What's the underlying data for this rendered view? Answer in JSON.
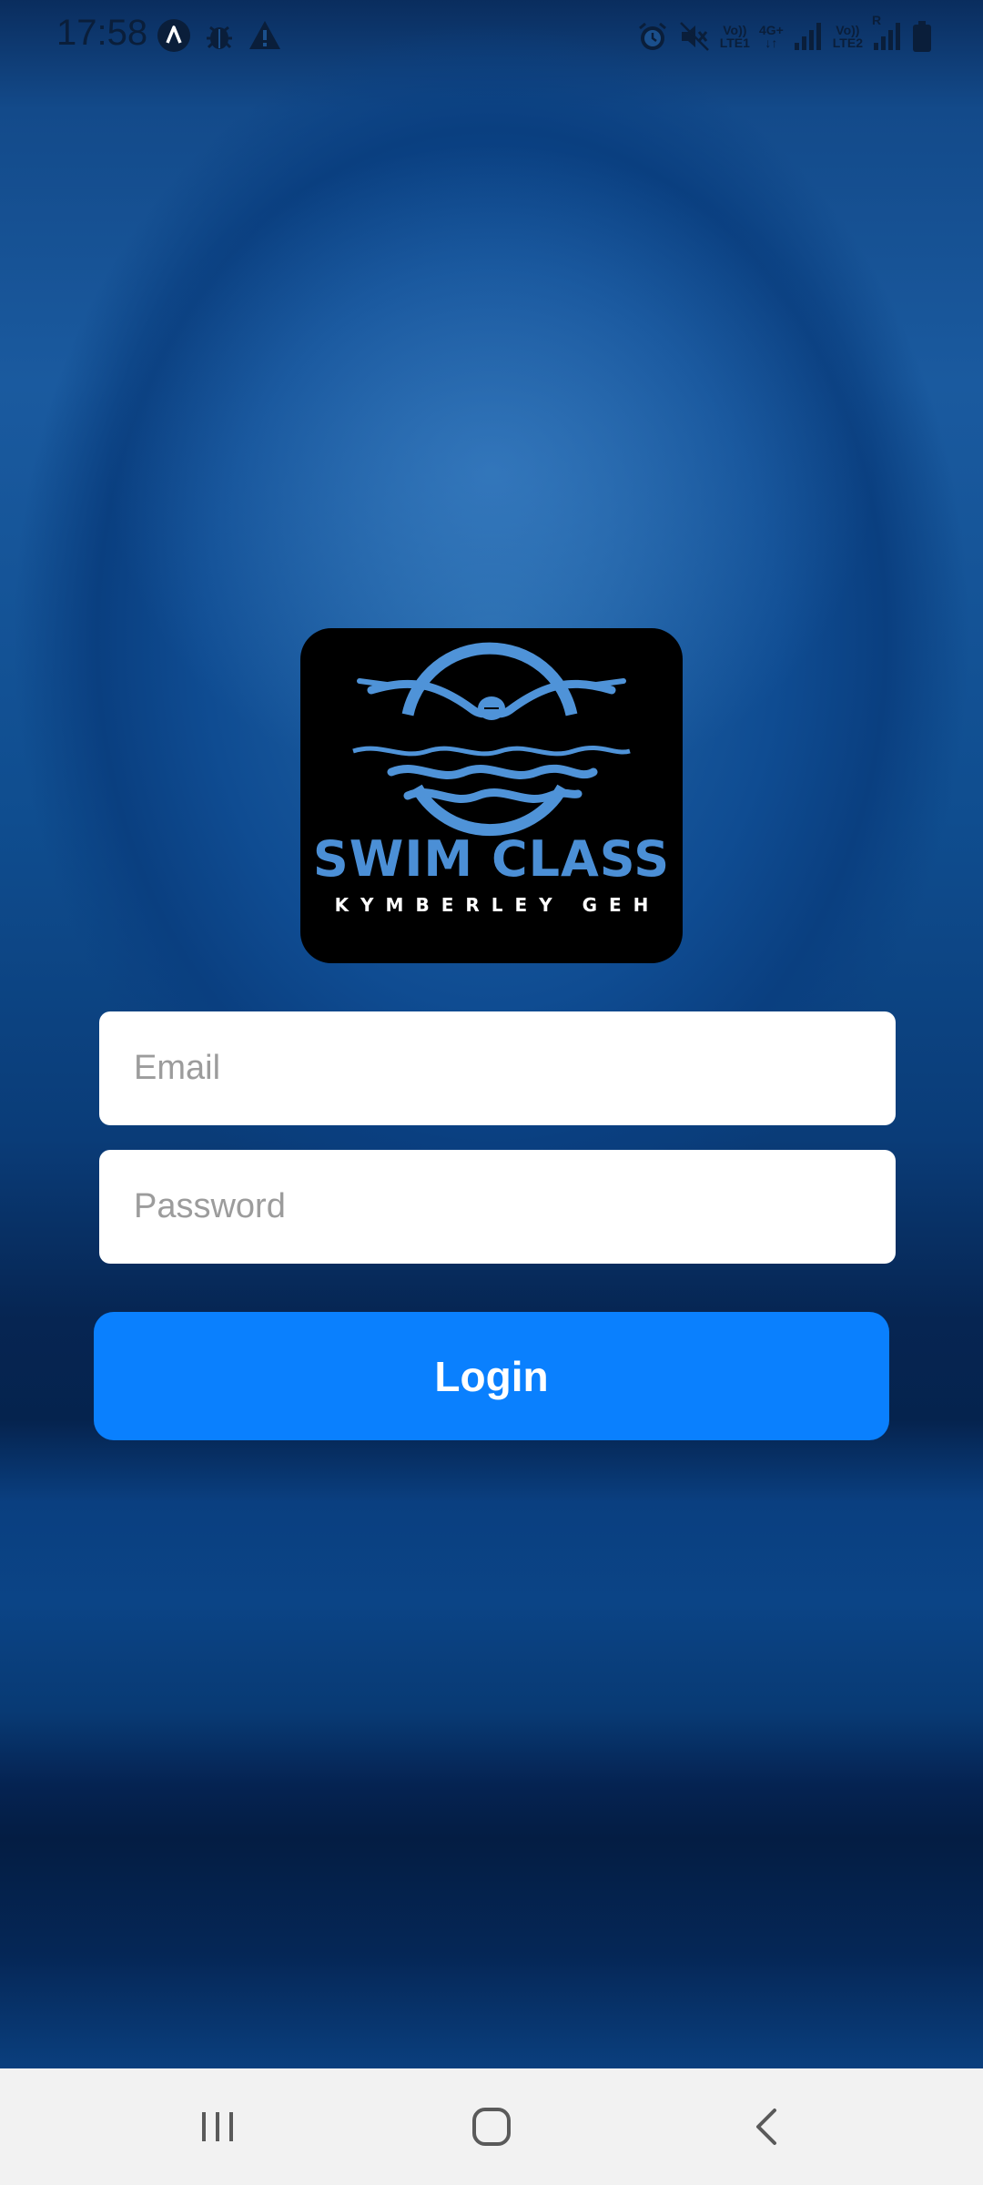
{
  "status_bar": {
    "time": "17:58",
    "left_icons": [
      "app-a-icon",
      "bug-icon",
      "warning-icon"
    ],
    "right_icons": [
      "alarm-icon",
      "mute-icon",
      "volte-lte1-icon",
      "4g-icon",
      "signal-1-icon",
      "volte-lte2-icon",
      "signal-2-icon",
      "battery-icon"
    ],
    "lte1_top": "Vo))",
    "lte1_bottom": "LTE1",
    "net_4g": "4G+",
    "lte2_top": "Vo))",
    "lte2_bottom": "LTE2",
    "roaming": "R"
  },
  "logo": {
    "title": "SWIM CLASS",
    "subtitle": "KYMBERLEY GEH",
    "title_color": "#4b8fd6"
  },
  "form": {
    "email_placeholder": "Email",
    "email_value": "",
    "password_placeholder": "Password",
    "password_value": "",
    "login_label": "Login",
    "accent_color": "#0a80fe"
  },
  "nav_bar": {
    "buttons": [
      "recents-icon",
      "home-icon",
      "back-icon"
    ]
  }
}
